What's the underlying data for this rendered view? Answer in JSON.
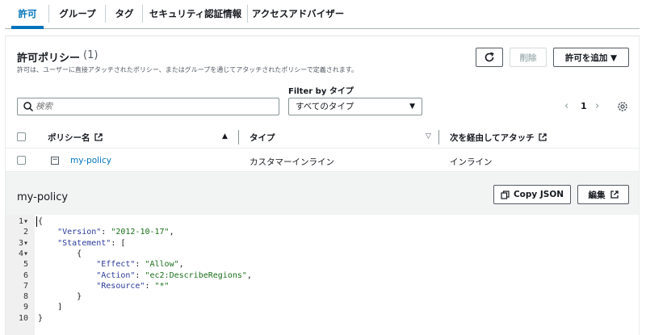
{
  "tabs": [
    {
      "label": "許可",
      "active": true
    },
    {
      "label": "グループ"
    },
    {
      "label": "タグ"
    },
    {
      "label": "セキュリティ認証情報"
    },
    {
      "label": "アクセスアドバイザー"
    }
  ],
  "panel": {
    "title": "許可ポリシー",
    "count": "(1)",
    "description": "許可は、ユーザーに直接アタッチされたポリシー、またはグループを通じてアタッチされたポリシーで定義されます。",
    "refresh_icon": "refresh-icon",
    "delete_label": "削除",
    "add_label": "許可を追加 ▼"
  },
  "filter": {
    "label": "Filter by タイプ",
    "search_placeholder": "検索",
    "type_value": "すべてのタイプ"
  },
  "pager": {
    "prev": "‹",
    "page": "1",
    "next": "›"
  },
  "table": {
    "headers": {
      "name": "ポリシー名",
      "type": "タイプ",
      "attached_via": "次を経由してアタッチ"
    },
    "rows": [
      {
        "name": "my-policy",
        "type": "カスタマーインライン",
        "attached_via": "インライン"
      }
    ]
  },
  "detail": {
    "title": "my-policy",
    "copy_label": "Copy JSON",
    "edit_label": "編集"
  },
  "code": {
    "line_numbers": [
      "1",
      "2",
      "3",
      "4",
      "5",
      "6",
      "7",
      "8",
      "9",
      "10"
    ],
    "fold_markers": [
      "1",
      "3",
      "4"
    ],
    "lines": [
      "{",
      "    \"Version\": \"2012-10-17\",",
      "    \"Statement\": [",
      "        {",
      "            \"Effect\": \"Allow\",",
      "            \"Action\": \"ec2:DescribeRegions\",",
      "            \"Resource\": \"*\"",
      "        }",
      "    ]",
      "}"
    ]
  },
  "colors": {
    "accent": "#0073bb",
    "key": "#2a3a9c",
    "string": "#1a6e1a"
  }
}
